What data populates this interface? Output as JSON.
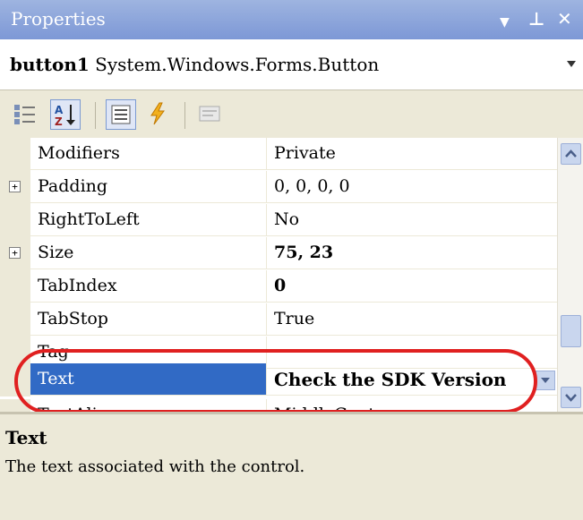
{
  "window": {
    "title": "Properties"
  },
  "object_selector": {
    "name": "button1",
    "type": "System.Windows.Forms.Button"
  },
  "toolbar": {
    "buttons": [
      {
        "icon": "categorized-icon",
        "active": false
      },
      {
        "icon": "alphabetical-sort-icon",
        "active": true
      },
      {
        "icon": "properties-icon",
        "active": true
      },
      {
        "icon": "events-lightning-icon",
        "active": false
      },
      {
        "icon": "property-pages-icon",
        "active": false
      }
    ]
  },
  "properties": [
    {
      "name": "Modifiers",
      "value": "Private",
      "expandable": false,
      "bold": false
    },
    {
      "name": "Padding",
      "value": "0, 0, 0, 0",
      "expandable": true,
      "bold": false
    },
    {
      "name": "RightToLeft",
      "value": "No",
      "expandable": false,
      "bold": false
    },
    {
      "name": "Size",
      "value": "75, 23",
      "expandable": true,
      "bold": true
    },
    {
      "name": "TabIndex",
      "value": "0",
      "expandable": false,
      "bold": true
    },
    {
      "name": "TabStop",
      "value": "True",
      "expandable": false,
      "bold": false
    },
    {
      "name": "Tag",
      "value": "",
      "expandable": false,
      "bold": false
    },
    {
      "name": "Text",
      "value": "Check the SDK Version",
      "expandable": false,
      "bold": true,
      "selected": true
    },
    {
      "name": "TextAlign",
      "value": "MiddleCenter",
      "expandable": false,
      "bold": false
    }
  ],
  "expander_symbol": "+",
  "description": {
    "title": "Text",
    "text": "The text associated with the control."
  },
  "colors": {
    "selection": "#316ac5",
    "highlight_ring": "#e02020",
    "titlebar": "#7d98d6"
  }
}
